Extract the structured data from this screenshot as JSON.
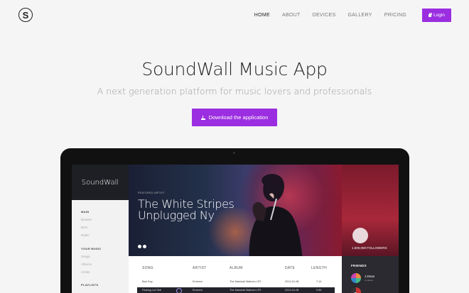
{
  "header": {
    "logo_letter": "S",
    "nav": [
      "HOME",
      "ABOUT",
      "DEVICES",
      "GALLERY",
      "PRICING"
    ],
    "active_nav": "HOME",
    "login_label": "Login"
  },
  "hero": {
    "title": "SoundWall Music App",
    "subtitle": "A next generation platform for music lovers and professionals",
    "download_label": "Download the application"
  },
  "app": {
    "brand": "SoundWall",
    "sidebar": {
      "main_heading": "MAIN",
      "main_items": [
        "Browse",
        "Born",
        "Radio"
      ],
      "music_heading": "YOUR MUSIC",
      "music_items": [
        "Songs",
        "Albums",
        "Artists"
      ],
      "playlists_heading": "PLAYLISTS"
    },
    "featured_label": "FEATURED ARTIST",
    "featured_line1": "The White Stripes",
    "featured_line2": "Unplugged Ny",
    "followers": "1,500,000 FOLLOWERS",
    "friends_heading": "FRIENDS",
    "friends": [
      {
        "name": "J.Dean",
        "sub": "2 Listens"
      },
      {
        "name": "",
        "sub": ""
      }
    ],
    "table": {
      "columns": [
        "SONG",
        "ARTIST",
        "ALBUM",
        "DATE",
        "LENGTH"
      ],
      "rows": [
        [
          "Bad Guy",
          "Eminem",
          "The Marshall Mathers LP2",
          "2013-01-08",
          "7:14"
        ],
        [
          "Parking Lot Skit",
          "Eminem",
          "The Marshall Mathers LP2",
          "2013-01-08",
          "0:56"
        ]
      ]
    }
  },
  "colors": {
    "accent": "#9b2ee0",
    "background": "#f5f5f6"
  }
}
